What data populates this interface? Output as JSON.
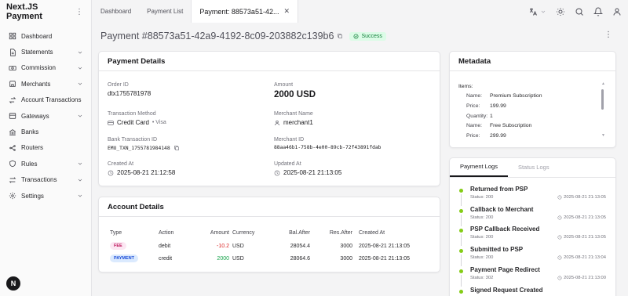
{
  "app": {
    "name": "Next.JS Payment",
    "avatar_letter": "N"
  },
  "sidebar": {
    "items": [
      {
        "label": "Dashboard",
        "icon": "dashboard-icon",
        "chevron": false
      },
      {
        "label": "Statements",
        "icon": "statements-icon",
        "chevron": true
      },
      {
        "label": "Commission",
        "icon": "commission-icon",
        "chevron": true
      },
      {
        "label": "Merchants",
        "icon": "merchants-icon",
        "chevron": true
      },
      {
        "label": "Account Transactions",
        "icon": "transfer-icon",
        "chevron": false
      },
      {
        "label": "Gateways",
        "icon": "gateways-icon",
        "chevron": true
      },
      {
        "label": "Banks",
        "icon": "banks-icon",
        "chevron": false
      },
      {
        "label": "Routers",
        "icon": "routers-icon",
        "chevron": false
      },
      {
        "label": "Rules",
        "icon": "rules-icon",
        "chevron": true
      },
      {
        "label": "Transactions",
        "icon": "transactions-icon",
        "chevron": true
      },
      {
        "label": "Settings",
        "icon": "settings-icon",
        "chevron": true
      }
    ]
  },
  "tabs": [
    {
      "label": "Dashboard"
    },
    {
      "label": "Payment List"
    },
    {
      "label": "Payment: 88573a51-42..."
    }
  ],
  "page": {
    "title": "Payment #88573a51-42a9-4192-8c09-203882c139b6",
    "status": "Success"
  },
  "payment_details": {
    "heading": "Payment Details",
    "order_id_label": "Order ID",
    "order_id": "dtx1755781978",
    "amount_label": "Amount",
    "amount": "2000 USD",
    "method_label": "Transaction Method",
    "method": "Credit Card",
    "method_brand": "• Visa",
    "merchant_name_label": "Merchant Name",
    "merchant_name": "merchant1",
    "bank_txn_label": "Bank Transaction ID",
    "bank_txn": "EMU_TXN_1755781984148",
    "merchant_id_label": "Merchant ID",
    "merchant_id": "88aa46b1-758b-4e00-89cb-72f43891fdab",
    "created_label": "Created At",
    "created": "2025-08-21 21:12:58",
    "updated_label": "Updated At",
    "updated": "2025-08-21 21:13:05"
  },
  "account_details": {
    "heading": "Account Details",
    "columns": [
      "Type",
      "Action",
      "Amount",
      "Currency",
      "Bal.After",
      "Res.After",
      "Created At"
    ],
    "rows": [
      {
        "type": "FEE",
        "action": "debit",
        "amount": "-10.2",
        "currency": "USD",
        "bal_after": "28054.4",
        "res_after": "3000",
        "created": "2025-08-21 21:13:05"
      },
      {
        "type": "PAYMENT",
        "action": "credit",
        "amount": "2000",
        "currency": "USD",
        "bal_after": "28064.6",
        "res_after": "3000",
        "created": "2025-08-21 21:13:05"
      }
    ]
  },
  "metadata": {
    "heading": "Metadata",
    "items_label": "Items:",
    "lines": [
      {
        "k": "Name:",
        "v": "Premium Subscription"
      },
      {
        "k": "Price:",
        "v": "199.99"
      },
      {
        "k": "Quantity:",
        "v": "1"
      },
      {
        "k": "Name:",
        "v": "Free Subscription"
      },
      {
        "k": "Price:",
        "v": "299.99"
      }
    ]
  },
  "logs": {
    "tabs": [
      "Payment Logs",
      "Status Logs"
    ],
    "entries": [
      {
        "title": "Returned from PSP",
        "status": "Status: 200",
        "time": "2025-08-21 21:13:05"
      },
      {
        "title": "Callback to Merchant",
        "status": "Status: 200",
        "time": "2025-08-21 21:13:05"
      },
      {
        "title": "PSP Callback Received",
        "status": "Status: 200",
        "time": "2025-08-21 21:13:05"
      },
      {
        "title": "Submitted to PSP",
        "status": "Status: 200",
        "time": "2025-08-21 21:13:04"
      },
      {
        "title": "Payment Page Redirect",
        "status": "Status: 302",
        "time": "2025-08-21 21:13:00"
      },
      {
        "title": "Signed Request Created",
        "status": "",
        "time": ""
      }
    ]
  },
  "colors": {
    "success": "#15803d",
    "fee_bg": "#fce7f3",
    "fee_fg": "#be185d",
    "payment_bg": "#dbeafe",
    "payment_fg": "#1d4ed8",
    "neg": "#dc2626",
    "posv": "#16a34a",
    "log_dot": "#84cc16"
  }
}
